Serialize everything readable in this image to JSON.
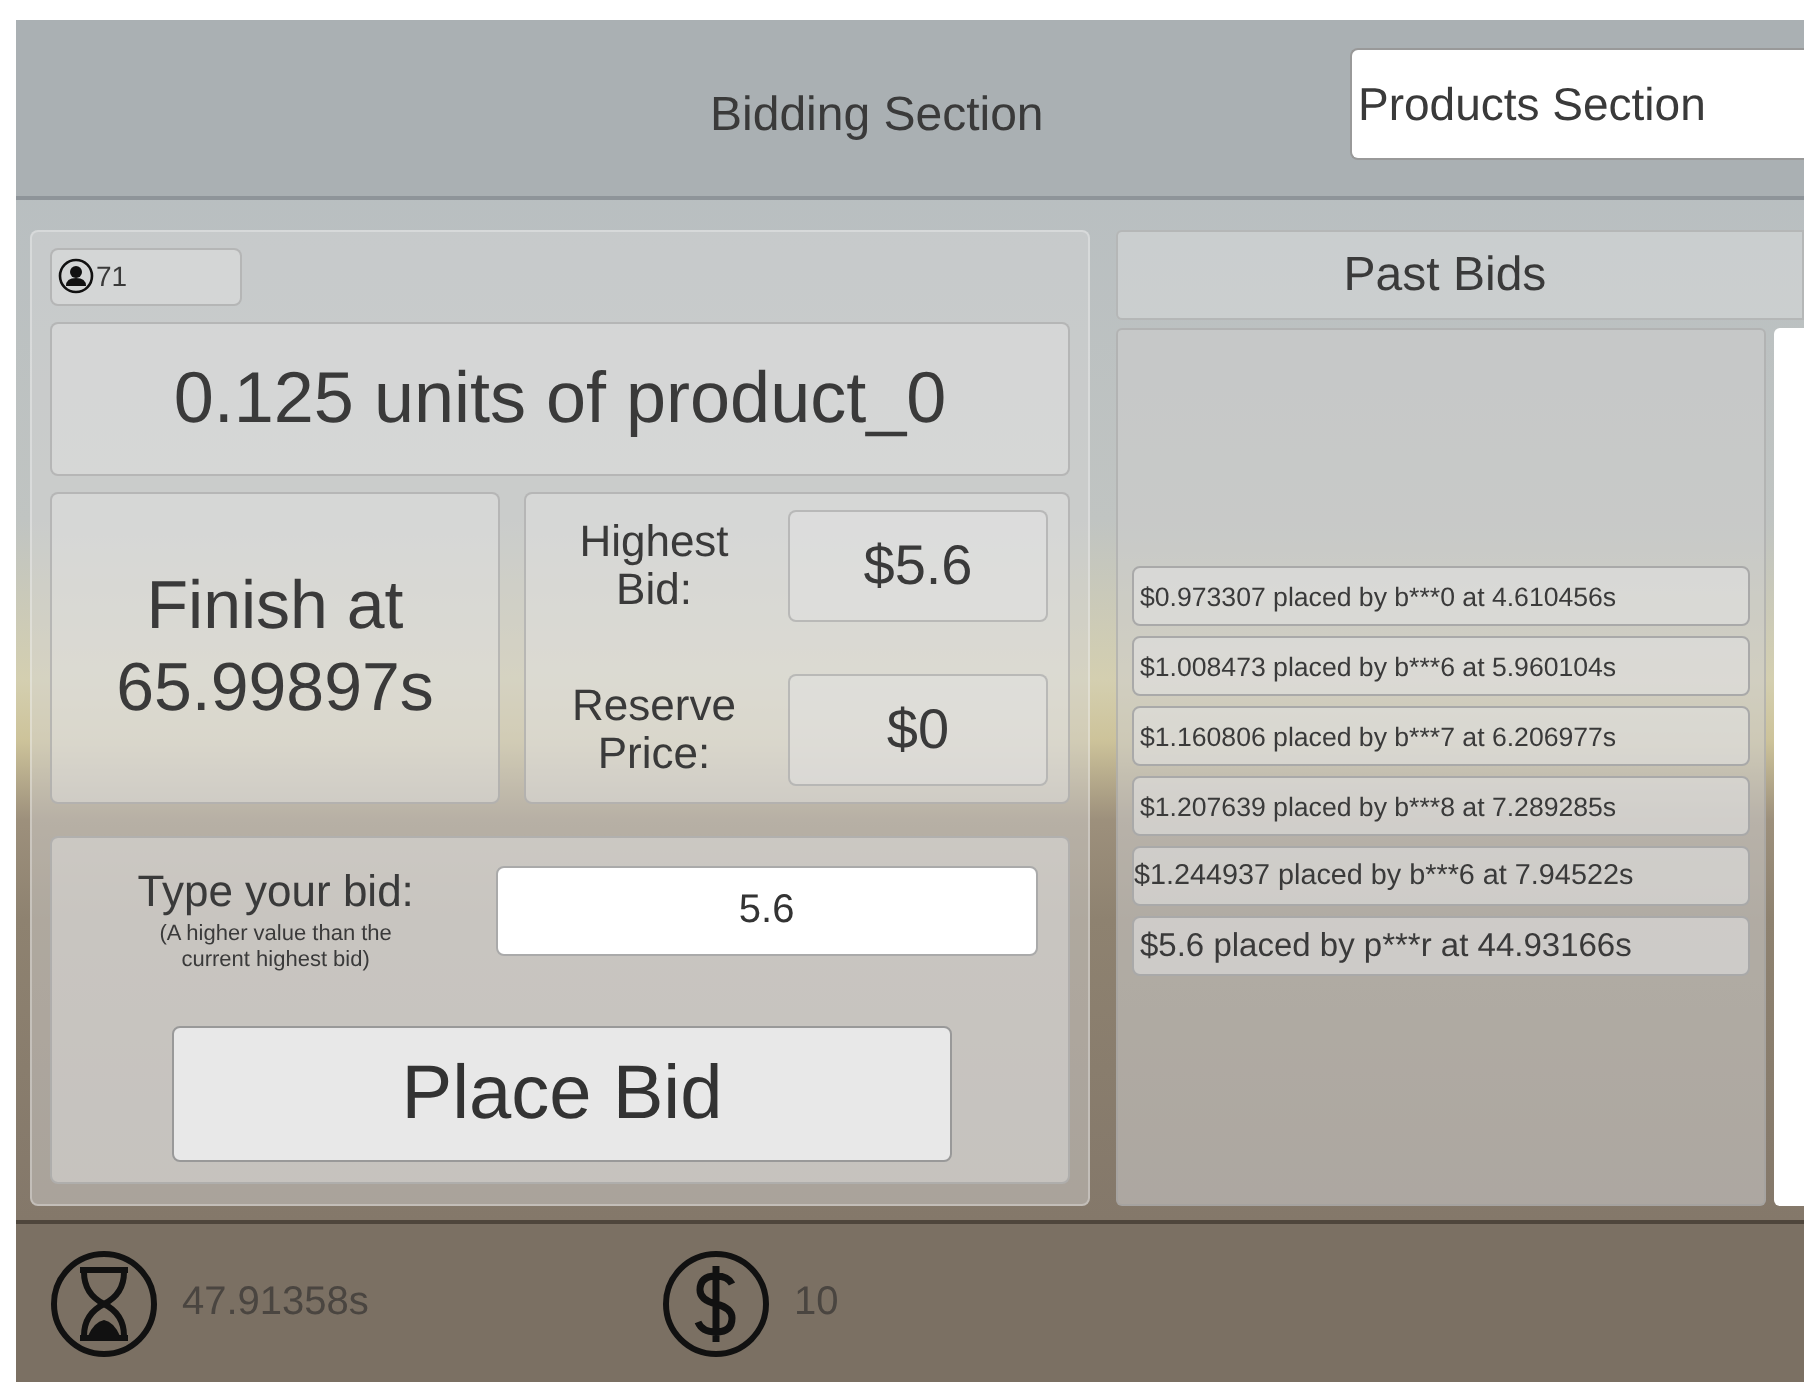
{
  "header": {
    "title": "Bidding Section",
    "products_button": "Products Section"
  },
  "auction": {
    "participants": "71",
    "product": "0.125 units of product_0",
    "finish": "Finish at 65.99897s",
    "highest_label": "Highest Bid:",
    "highest_value": "$5.6",
    "reserve_label": "Reserve Price:",
    "reserve_value": "$0",
    "bid_label": "Type your bid:",
    "bid_hint": "(A higher value than the current highest bid)",
    "bid_value": "5.6",
    "place_button": "Place Bid"
  },
  "past_bids": {
    "title": "Past Bids",
    "bids": [
      "$0.973307 placed by b***0 at 4.610456s",
      "$1.008473 placed by b***6 at 5.960104s",
      "$1.160806 placed by b***7 at 6.206977s",
      "$1.207639 placed by b***8 at 7.289285s",
      "$1.244937 placed by b***6 at 7.94522s",
      "$5.6 placed by p***r at 44.93166s"
    ]
  },
  "status_bar": {
    "time": "47.91358s",
    "money": "10"
  }
}
